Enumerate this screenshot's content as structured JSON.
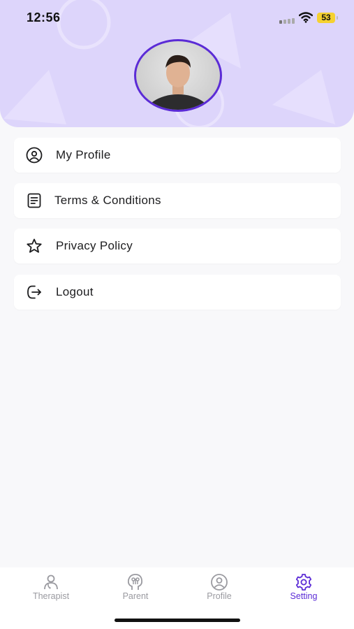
{
  "status_bar": {
    "time": "12:56",
    "battery": "53"
  },
  "menu": [
    {
      "label": "My Profile",
      "icon": "user-circle-icon"
    },
    {
      "label": "Terms & Conditions",
      "icon": "document-icon"
    },
    {
      "label": "Privacy Policy",
      "icon": "star-icon"
    },
    {
      "label": "Logout",
      "icon": "logout-icon"
    }
  ],
  "tabs": [
    {
      "label": "Therapist",
      "icon": "therapist-icon",
      "active": false
    },
    {
      "label": "Parent",
      "icon": "parent-icon",
      "active": false
    },
    {
      "label": "Profile",
      "icon": "profile-icon",
      "active": false
    },
    {
      "label": "Setting",
      "icon": "gear-icon",
      "active": true
    }
  ],
  "colors": {
    "header_bg": "#ddd5fb",
    "accent": "#5b2bd6",
    "inactive": "#9a9aa0",
    "page_bg": "#f8f8fa",
    "battery": "#f5d130"
  }
}
